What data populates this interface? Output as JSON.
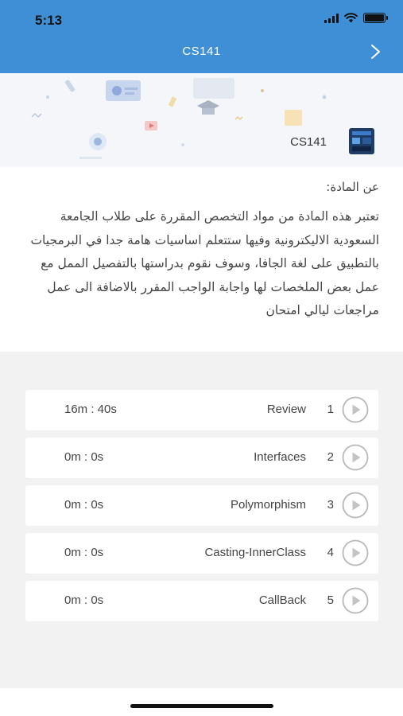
{
  "status_bar": {
    "time": "5:13"
  },
  "nav": {
    "title": "CS141",
    "forward_icon": "chevron-right-icon"
  },
  "banner": {
    "course_code": "CS141"
  },
  "about": {
    "heading": "عن المادة:",
    "body": "تعتبر هذه المادة من مواد التخصص المقررة على طلاب الجامعة السعودية الاليكترونية وفيها ستتعلم اساسيات هامة جدا في البرمجيات بالتطبيق على لغة الجافا، وسوف نقوم بدراستها بالتفصيل الممل مع عمل بعض الملخصات لها واجابة الواجب المقرر بالاضافة الى عمل مراجعات ليالي امتحان"
  },
  "lessons": [
    {
      "index": "1",
      "title": "Review",
      "duration": "16m : 40s"
    },
    {
      "index": "2",
      "title": "Interfaces",
      "duration": "0m : 0s"
    },
    {
      "index": "3",
      "title": "Polymorphism",
      "duration": "0m : 0s"
    },
    {
      "index": "4",
      "title": "Casting-InnerClass",
      "duration": "0m : 0s"
    },
    {
      "index": "5",
      "title": "CallBack",
      "duration": "0m : 0s"
    }
  ],
  "colors": {
    "nav_bar": "#3f8fd6",
    "background": "#f2f2f2",
    "card": "#ffffff",
    "text": "#444444"
  }
}
